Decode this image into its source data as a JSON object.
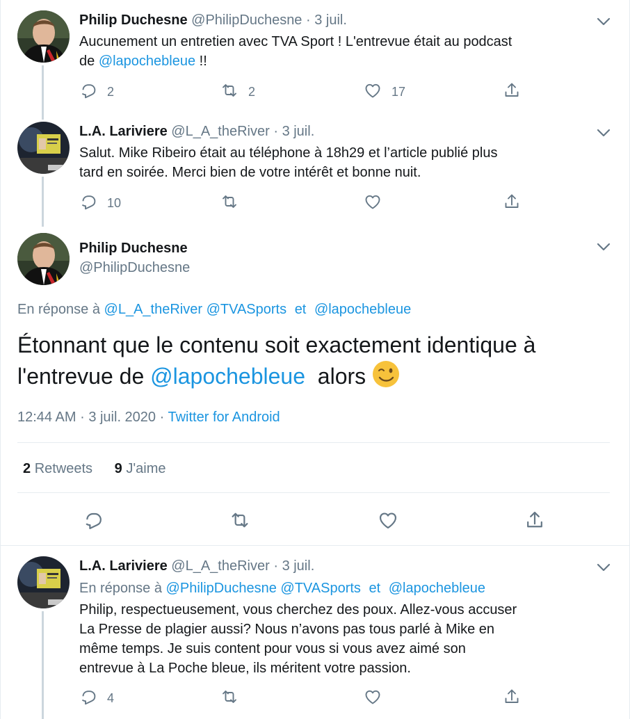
{
  "tweets": {
    "t1": {
      "name": "Philip Duchesne",
      "handle": "@PhilipDuchesne",
      "dot": "·",
      "date": "3 juil.",
      "text_a": "Aucunement un entretien avec TVA Sport ! L'entrevue était au podcast",
      "text_b": "de",
      "mention": "@lapochebleue",
      "text_c": "!!",
      "replies": "2",
      "retweets": "2",
      "likes": "17"
    },
    "t2": {
      "name": "L.A. Lariviere",
      "handle": "@L_A_theRiver",
      "dot": "·",
      "date": "3 juil.",
      "text_a": "Salut. Mike Ribeiro était au téléphone à 18h29 et l’article publié plus",
      "text_b": "tard en soirée. Merci bien de votre intérêt et bonne nuit.",
      "replies": "10"
    },
    "main": {
      "name": "Philip Duchesne",
      "handle": "@PhilipDuchesne",
      "reply_prefix": "En réponse à",
      "reply_to_1": "@L_A_theRiver",
      "reply_to_2": "@TVASports",
      "reply_and": "et",
      "reply_to_3": "@lapochebleue",
      "text_a": "Étonnant que le contenu soit exactement identique à",
      "text_b": "l'entrevue de",
      "mention": "@lapochebleue",
      "text_c": "alors",
      "emoji": "😉",
      "time": "12:44 AM",
      "dot": "·",
      "full_date": "3 juil. 2020",
      "dot2": "·",
      "source": "Twitter for Android",
      "retweets_count": "2",
      "retweets_label": "Retweets",
      "likes_count": "9",
      "likes_label": "J'aime"
    },
    "t4": {
      "name": "L.A. Lariviere",
      "handle": "@L_A_theRiver",
      "dot": "·",
      "date": "3 juil.",
      "reply_prefix": "En réponse à",
      "reply_to_1": "@PhilipDuchesne",
      "reply_to_2": "@TVASports",
      "reply_and": "et",
      "reply_to_3": "@lapochebleue",
      "line1": "Philip, respectueusement, vous cherchez des poux. Allez-vous accuser",
      "line2": "La Presse de plagier aussi? Nous n’avons pas tous parlé à Mike en",
      "line3": "même temps. Je suis content pour vous si vous avez aimé son",
      "line4": "entrevue à La Poche bleue, ils méritent votre passion.",
      "replies": "4"
    }
  },
  "colors": {
    "link": "#1b95e0",
    "muted": "#657786",
    "text": "#14171a",
    "divider": "#e6ecf0",
    "thread_line": "#ccd6dd"
  },
  "icons": [
    "reply-icon",
    "retweet-icon",
    "like-icon",
    "share-icon",
    "chevron-down-icon"
  ]
}
